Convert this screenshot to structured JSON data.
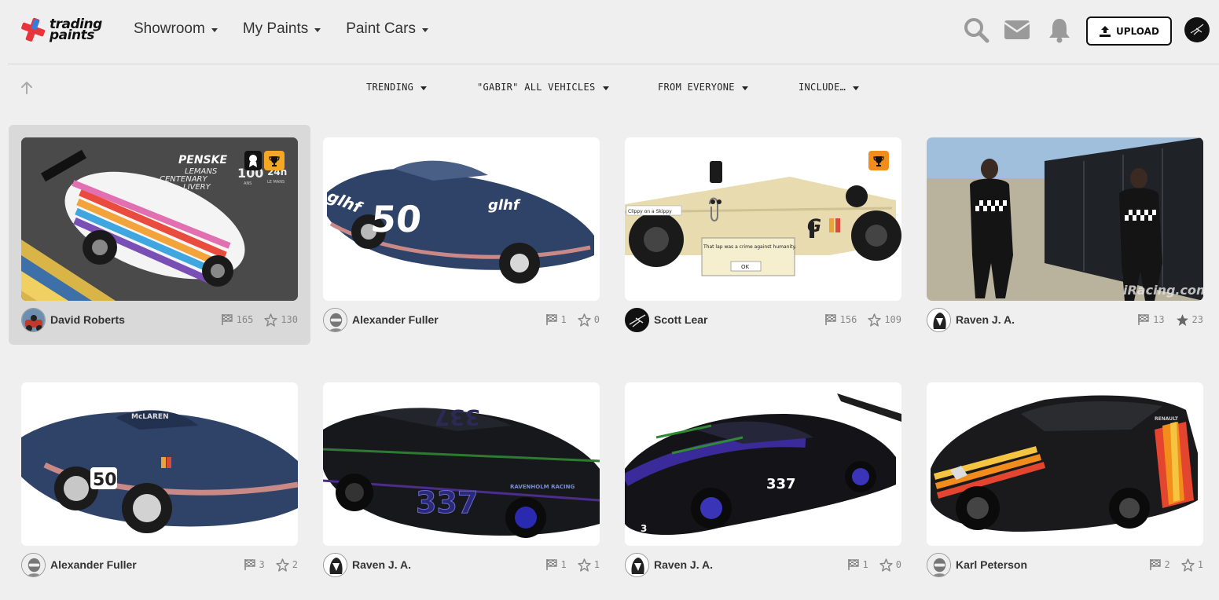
{
  "brand": {
    "line1": "trading",
    "line2": "paints"
  },
  "nav": {
    "items": [
      {
        "label": "Showroom"
      },
      {
        "label": "My Paints"
      },
      {
        "label": "Paint Cars"
      }
    ]
  },
  "header": {
    "upload_label": "UPLOAD",
    "icons": [
      "search-icon",
      "mail-icon",
      "bell-icon",
      "upload-icon"
    ]
  },
  "filters": [
    {
      "label": "TRENDING"
    },
    {
      "label": "\"GABIR\" ALL VEHICLES"
    },
    {
      "label": "FROM EVERYONE"
    },
    {
      "label": "INCLUDE…"
    }
  ],
  "cards": [
    {
      "user": "David Roberts",
      "races": "165",
      "stars": "130",
      "starred": false,
      "thumb_text": {
        "brand": "PENSKE",
        "line1": "LEMANS",
        "line2": "CENTENARY",
        "line3": "LIVERY",
        "big": "100",
        "small": "ANS",
        "hours": "24h",
        "place": "LE MANS"
      }
    },
    {
      "user": "Alexander Fuller",
      "races": "1",
      "stars": "0",
      "starred": false,
      "thumb_text": {
        "number": "50",
        "sponsor": "glhf"
      }
    },
    {
      "user": "Scott Lear",
      "races": "156",
      "stars": "109",
      "starred": false,
      "thumb_text": {
        "caption": "Clippy on a Skippy",
        "dialog": "That lap was a crime against humanity.",
        "ok": "OK"
      }
    },
    {
      "user": "Raven J. A.",
      "races": "13",
      "stars": "23",
      "starred": true,
      "thumb_text": {
        "watermark": "iRacing.com"
      }
    },
    {
      "user": "Alexander Fuller",
      "races": "3",
      "stars": "2",
      "starred": false,
      "thumb_text": {
        "number": "50",
        "make": "McLAREN"
      }
    },
    {
      "user": "Raven J. A.",
      "races": "1",
      "stars": "1",
      "starred": false,
      "thumb_text": {
        "number": "337",
        "team": "RAVENHOLM RACING"
      }
    },
    {
      "user": "Raven J. A.",
      "races": "1",
      "stars": "0",
      "starred": false,
      "thumb_text": {
        "number": "337"
      }
    },
    {
      "user": "Karl Peterson",
      "races": "2",
      "stars": "1",
      "starred": false,
      "thumb_text": {
        "make": "RENAULT"
      }
    }
  ],
  "colors": {
    "accent_red": "#e8353a",
    "accent_blue": "#2f7fe0",
    "badge_orange": "#f28c1b",
    "badge_yellow": "#f5a623"
  }
}
